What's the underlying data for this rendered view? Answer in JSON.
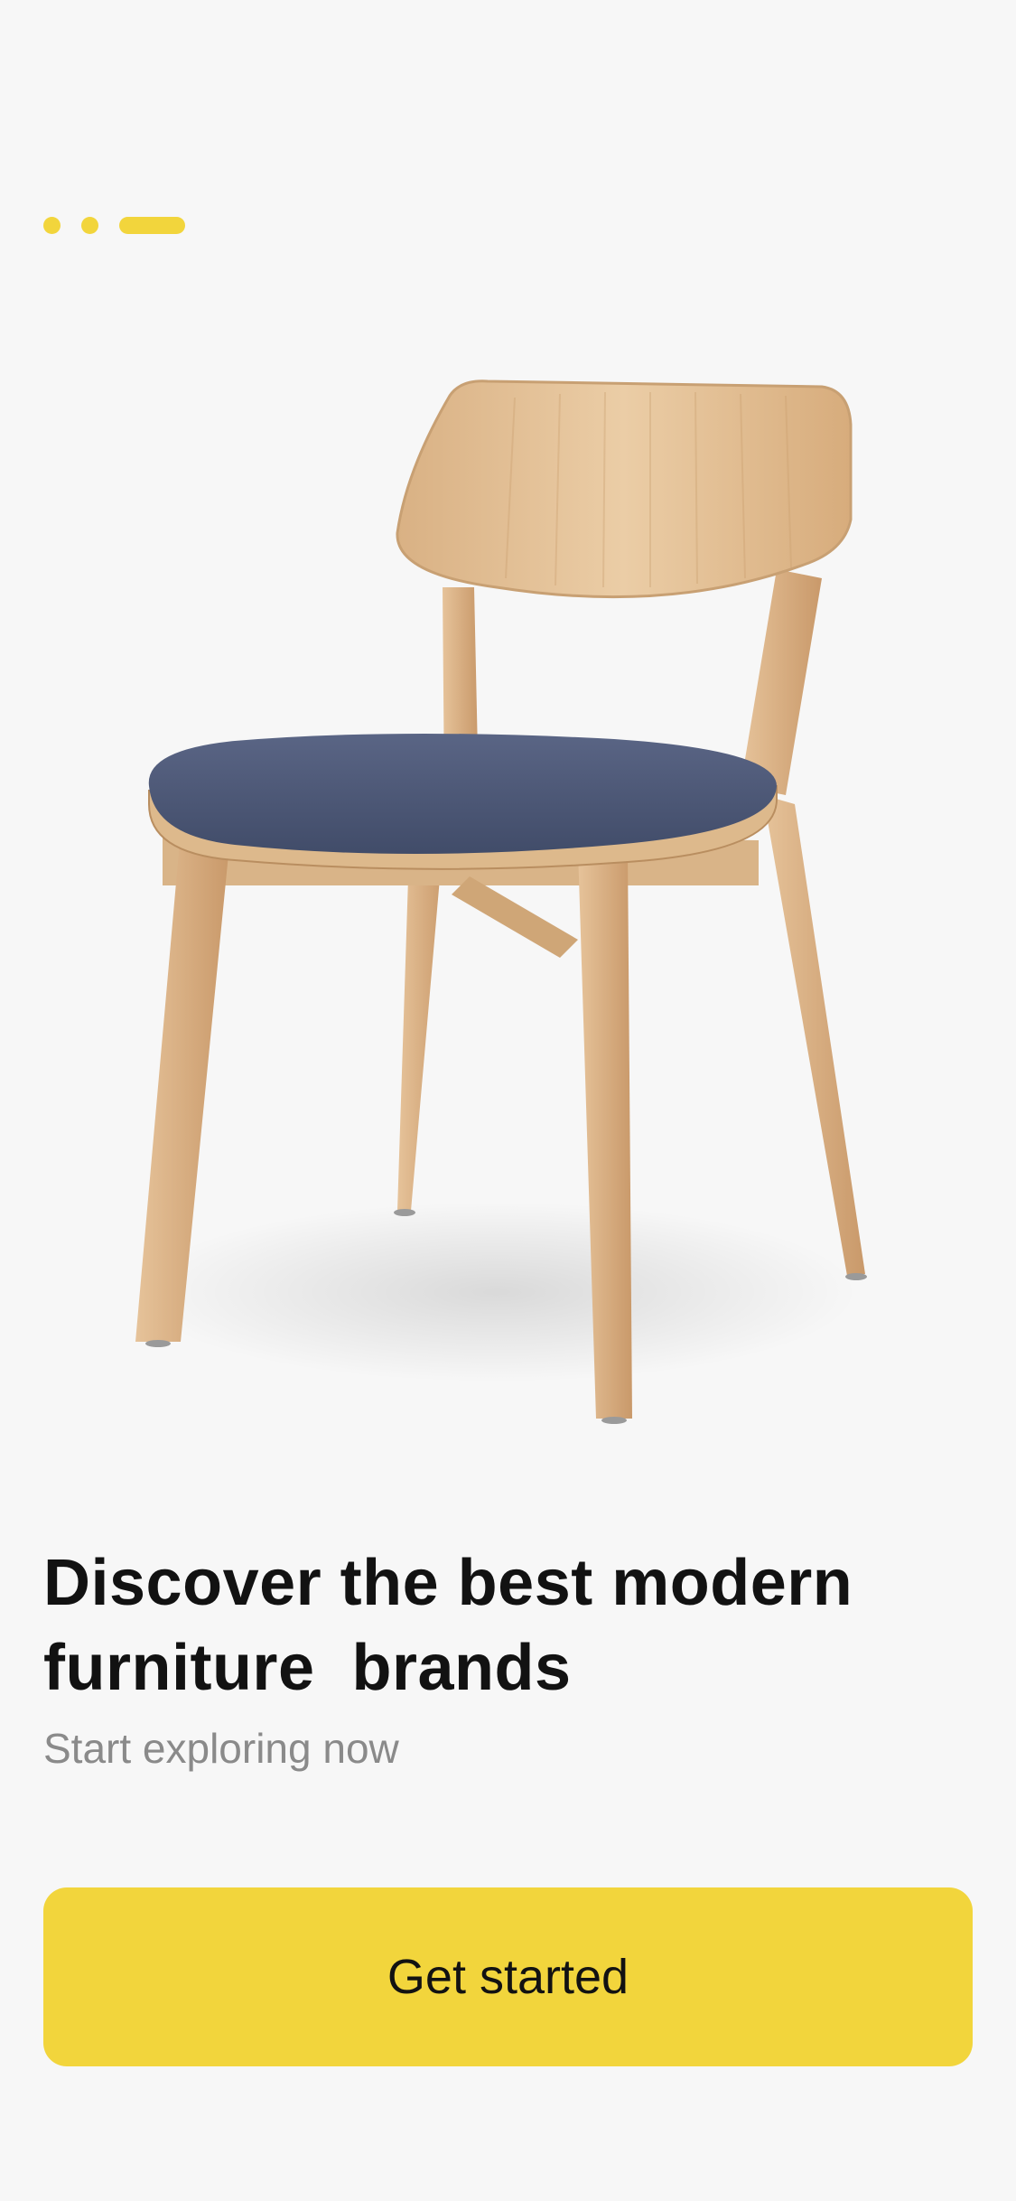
{
  "colors": {
    "accent": "#F2D53C",
    "background": "#F7F7F7",
    "headline": "#121212",
    "subheadline": "#8A8A8A",
    "wood": "#E2BE93",
    "seat": "#4E5A78"
  },
  "onboarding": {
    "page_indicator": {
      "total": 3,
      "active_index": 2
    },
    "hero_image": "wooden-chair-with-blue-seat",
    "headline_lines": [
      "Discover the best modern",
      "furniture  brands"
    ],
    "subheadline": "Start exploring now",
    "cta_label": "Get started"
  }
}
